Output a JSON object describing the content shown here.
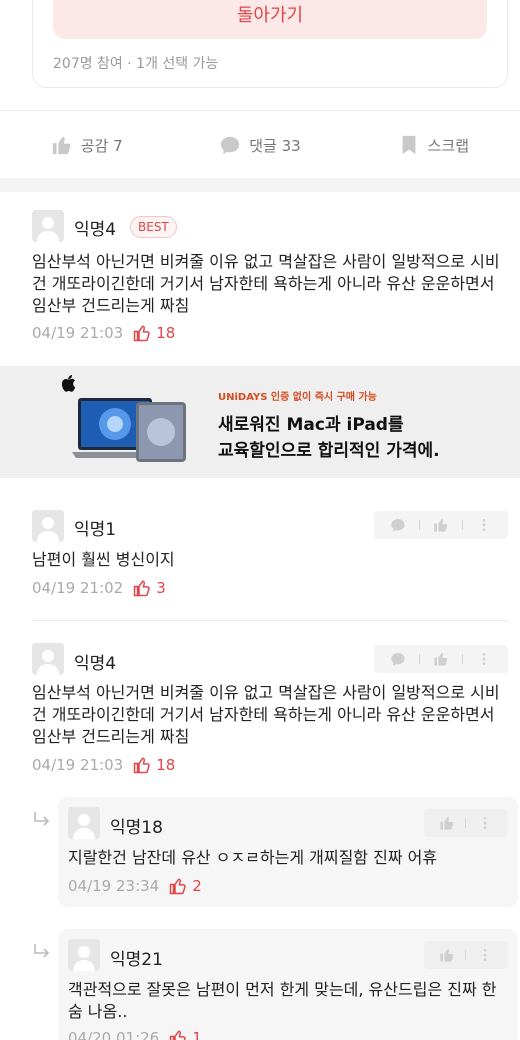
{
  "poll": {
    "back_label": "돌아가기",
    "meta": "207명 참여 · 1개 선택 가능"
  },
  "actions": {
    "like_label": "공감 7",
    "comment_label": "댓글 33",
    "scrap_label": "스크랩"
  },
  "comments": [
    {
      "author": "익명4",
      "badge": "BEST",
      "text": "임산부석 아닌거면 비켜줄 이유 없고 멱살잡은 사람이 일방적으로 시비건 개또라이긴한데 거기서 남자한테 욕하는게 아니라 유산 운운하면서 임산부 건드리는게 짜침",
      "time": "04/19 21:03",
      "likes": "18"
    },
    {
      "author": "익명1",
      "text": "남편이 훨씬 병신이지",
      "time": "04/19 21:02",
      "likes": "3"
    },
    {
      "author": "익명4",
      "text": "임산부석 아닌거면 비켜줄 이유 없고 멱살잡은 사람이 일방적으로 시비건 개또라이긴한데 거기서 남자한테 욕하는게 아니라 유산 운운하면서 임산부 건드리는게 짜침",
      "time": "04/19 21:03",
      "likes": "18"
    }
  ],
  "replies": [
    {
      "author": "익명18",
      "text": "지랄한건 남잔데 유산 ㅇㅈㄹ하는게 개찌질함 진짜 어휴",
      "time": "04/19 23:34",
      "likes": "2"
    },
    {
      "author": "익명21",
      "text": "객관적으로 잘못은 남편이 먼저 한게 맞는데, 유산드립은 진짜 한숨 나옴..",
      "time": "04/20 01:26",
      "likes": "1"
    }
  ],
  "ad": {
    "tag": "UNiDAYS 인증 없이 즉시 구매 가능",
    "line1": "새로워진 Mac과 iPad를",
    "line2": "교육할인으로 합리적인 가격에."
  },
  "colors": {
    "accent": "#e0464a",
    "muted": "#aaaaaa"
  },
  "icons": [
    "thumbs-up-icon",
    "comment-icon",
    "bookmark-icon",
    "reply-arrow-icon",
    "apple-logo-icon",
    "avatar-icon"
  ]
}
